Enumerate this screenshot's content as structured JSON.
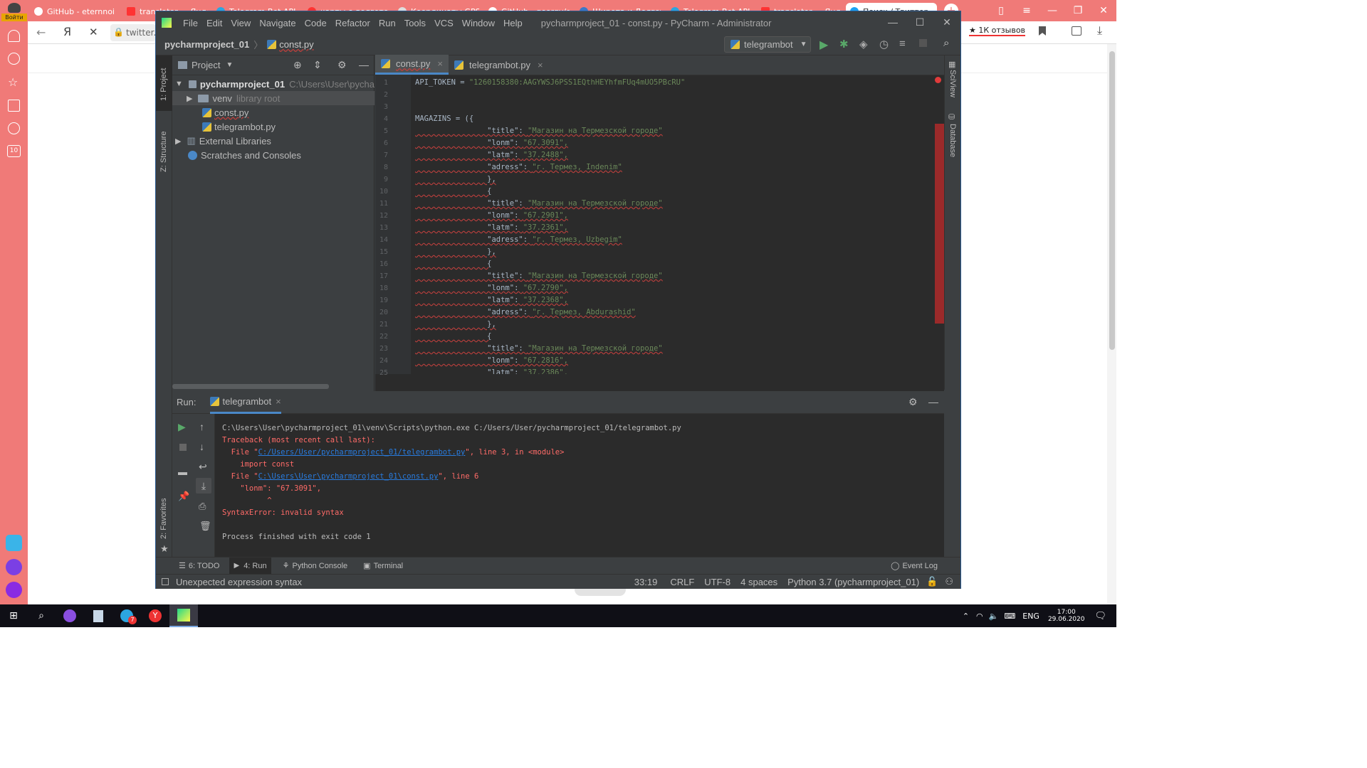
{
  "browser": {
    "tabs": [
      {
        "label": "GitHub - eternnoir/"
      },
      {
        "label": "translator — Янде"
      },
      {
        "label": "Telegram Bot API"
      },
      {
        "label": "карты с долготой"
      },
      {
        "label": "Координаты GPS"
      },
      {
        "label": "GitHub - georgy/g"
      },
      {
        "label": "Широта и Долгота"
      },
      {
        "label": "Telegram Bot API"
      },
      {
        "label": "translator — Янде"
      },
      {
        "label": "Поиск / Твиттер"
      }
    ],
    "login_label": "Войти",
    "address_text": "twitter.",
    "reviews_label": "★ 1К отзывов",
    "sidebar_badge": "10"
  },
  "pycharm": {
    "menu": [
      "File",
      "Edit",
      "View",
      "Navigate",
      "Code",
      "Refactor",
      "Run",
      "Tools",
      "VCS",
      "Window",
      "Help"
    ],
    "window_title": "pycharmproject_01 - const.py - PyCharm - Administrator",
    "breadcrumb": {
      "project": "pycharmproject_01",
      "file": "const.py"
    },
    "run_config": "telegrambot",
    "left_strip": {
      "project": "1: Project",
      "structure": "Z: Structure",
      "favorites": "2: Favorites"
    },
    "right_strip": {
      "sciview": "SciView",
      "database": "Database"
    },
    "project_panel": {
      "title": "Project",
      "root": "pycharmproject_01",
      "root_path": "C:\\Users\\User\\pycha",
      "venv": "venv",
      "venv_hint": "library root",
      "files": [
        "const.py",
        "telegrambot.py"
      ],
      "external": "External Libraries",
      "scratches": "Scratches and Consoles"
    },
    "editor_tabs": [
      {
        "label": "const.py"
      },
      {
        "label": "telegrambot.py"
      }
    ],
    "code_lines": [
      {
        "n": "1",
        "key": "API_TOKEN = ",
        "val": "\"1260158380:AAGYWSJ6PSS1EQthHEYhfmFUq4mUO5PBcRU\""
      },
      {
        "n": "2",
        "key": "",
        "val": ""
      },
      {
        "n": "3",
        "key": "",
        "val": ""
      },
      {
        "n": "4",
        "key": "MAGAZINS = ({",
        "val": ""
      },
      {
        "n": "5",
        "key": "                \"title\": ",
        "val": "\"Магазин на Термезской городе\""
      },
      {
        "n": "6",
        "key": "                \"lonm\": ",
        "val": "\"67.3091\","
      },
      {
        "n": "7",
        "key": "                \"latm\": ",
        "val": "\"37.2488\","
      },
      {
        "n": "8",
        "key": "                \"adress\": ",
        "val": "\"г. Термез, Indenim\""
      },
      {
        "n": "9",
        "key": "                },",
        "val": ""
      },
      {
        "n": "10",
        "key": "                {",
        "val": ""
      },
      {
        "n": "11",
        "key": "                \"title\": ",
        "val": "\"Магазин на Термезской городе\""
      },
      {
        "n": "12",
        "key": "                \"lonm\": ",
        "val": "\"67.2901\","
      },
      {
        "n": "13",
        "key": "                \"latm\": ",
        "val": "\"37.2361\","
      },
      {
        "n": "14",
        "key": "                \"adress\": ",
        "val": "\"г. Термез, Uzbegim\""
      },
      {
        "n": "15",
        "key": "                },",
        "val": ""
      },
      {
        "n": "16",
        "key": "                {",
        "val": ""
      },
      {
        "n": "17",
        "key": "                \"title\": ",
        "val": "\"Магазин на Термезской городе\""
      },
      {
        "n": "18",
        "key": "                \"lonm\": ",
        "val": "\"67.2790\","
      },
      {
        "n": "19",
        "key": "                \"latm\": ",
        "val": "\"37.2368\","
      },
      {
        "n": "20",
        "key": "                \"adress\": ",
        "val": "\"г. Термез, Abdurashid\""
      },
      {
        "n": "21",
        "key": "                },",
        "val": ""
      },
      {
        "n": "22",
        "key": "                {",
        "val": ""
      },
      {
        "n": "23",
        "key": "                \"title\": ",
        "val": "\"Магазин на Термезской городе\""
      },
      {
        "n": "24",
        "key": "                \"lonm\": ",
        "val": "\"67.2816\","
      },
      {
        "n": "25",
        "key": "                \"latm\": ",
        "val": "\"37.2386\","
      }
    ],
    "run": {
      "label": "Run:",
      "tab": "telegrambot",
      "console": [
        {
          "t": "C:\\Users\\User\\pycharmproject_01\\venv\\Scripts\\python.exe C:/Users/User/pycharmproject_01/telegrambot.py",
          "cls": ""
        },
        {
          "t": "Traceback (most recent call last):",
          "cls": "red"
        },
        {
          "t": "  File \"",
          "link": "C:/Users/User/pycharmproject_01/telegrambot.py",
          "tail": "\", line 3, in <module>",
          "cls": "red"
        },
        {
          "t": "    import const",
          "cls": "red"
        },
        {
          "t": "  File \"",
          "link": "C:\\Users\\User\\pycharmproject_01\\const.py",
          "tail": "\", line 6",
          "cls": "red"
        },
        {
          "t": "    \"lonm\": \"67.3091\",",
          "cls": "red"
        },
        {
          "t": "          ^",
          "cls": "red"
        },
        {
          "t": "SyntaxError: invalid syntax",
          "cls": "red"
        },
        {
          "t": "",
          "cls": ""
        },
        {
          "t": "Process finished with exit code 1",
          "cls": ""
        }
      ]
    },
    "bottom_tabs": {
      "todo": "6: TODO",
      "run": "4: Run",
      "python_console": "Python Console",
      "terminal": "Terminal",
      "event_log": "Event Log"
    },
    "status": {
      "message": "Unexpected expression syntax",
      "position": "33:19",
      "line_sep": "CRLF",
      "encoding": "UTF-8",
      "indent": "4 spaces",
      "interpreter": "Python 3.7 (pycharmproject_01)"
    }
  },
  "taskbar": {
    "lang": "ENG",
    "time": "17:00",
    "date": "29.06.2020",
    "telegram_badge": "7"
  }
}
